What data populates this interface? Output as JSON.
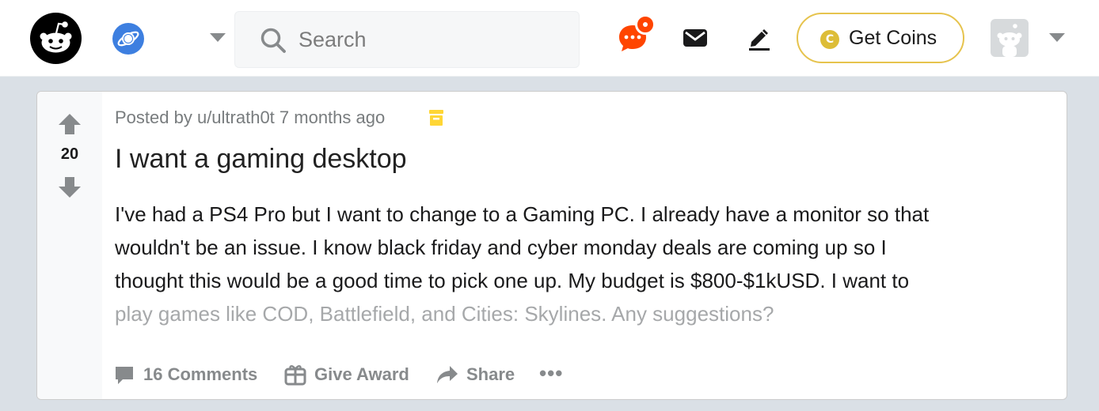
{
  "header": {
    "logo_icon": "reddit-snoo-logo",
    "community_icon": "planet-icon",
    "search": {
      "placeholder": "Search",
      "value": ""
    },
    "chat_icon": "chat-icon",
    "mail_icon": "mail-icon",
    "create_icon": "pencil-icon",
    "coins_label": "Get Coins",
    "coin_symbol": "C",
    "avatar_icon": "avatar-snoo",
    "accent_color": "#ff4500",
    "coin_color": "#ddbd37"
  },
  "post": {
    "score": "20",
    "meta_prefix": "Posted by ",
    "author": "u/ultrath0t",
    "age": " 7 months ago",
    "archive_icon": "archive-icon",
    "title": "I want a gaming desktop",
    "body_lines": [
      "I've had a PS4 Pro but I want to change to a Gaming PC. I already have a monitor so that",
      "wouldn't be an issue. I know black friday and cyber monday deals are coming up so I",
      "thought this would be a good time to pick one up. My budget is $800-$1kUSD. I want to",
      "play games like COD, Battlefield, and Cities: Skylines. Any suggestions?"
    ],
    "actions": {
      "comments": "16 Comments",
      "award": "Give Award",
      "share": "Share",
      "more": "•••"
    }
  }
}
